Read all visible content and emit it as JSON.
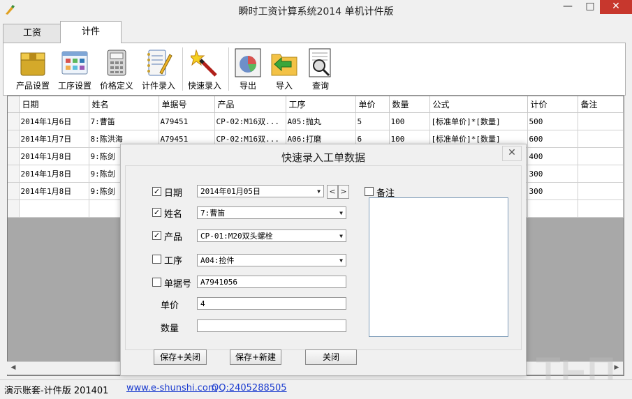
{
  "window": {
    "title": "瞬时工资计算系统2014 单机计件版",
    "minimize": "—",
    "maximize": "□",
    "close": "✕"
  },
  "tabs": [
    {
      "label": "工资",
      "active": false
    },
    {
      "label": "计件",
      "active": true
    }
  ],
  "toolbar": {
    "items": [
      {
        "label": "产品设置",
        "icon": "product-box-icon"
      },
      {
        "label": "工序设置",
        "icon": "process-grid-icon"
      },
      {
        "label": "价格定义",
        "icon": "calculator-icon"
      },
      {
        "label": "计件录入",
        "icon": "notebook-pencil-icon"
      },
      {
        "label": "快速录入",
        "icon": "magic-wand-icon"
      },
      {
        "label": "导出",
        "icon": "export-chart-icon"
      },
      {
        "label": "导入",
        "icon": "import-folder-icon"
      },
      {
        "label": "查询",
        "icon": "search-document-icon"
      }
    ]
  },
  "grid": {
    "columns": [
      "日期",
      "姓名",
      "单据号",
      "产品",
      "工序",
      "单价",
      "数量",
      "公式",
      "计价",
      "备注"
    ],
    "rows": [
      [
        "2014年1月6日",
        "7:曹笛",
        "A79451",
        "CP-02:M16双...",
        "A05:抛丸",
        "5",
        "100",
        "[标准单价]*[数量]",
        "500",
        ""
      ],
      [
        "2014年1月7日",
        "8:陈洪海",
        "A79451",
        "CP-02:M16双...",
        "A06:打磨",
        "6",
        "100",
        "[标准单价]*[数量]",
        "600",
        ""
      ],
      [
        "2014年1月8日",
        "9:陈剑",
        "",
        "",
        "",
        "",
        "",
        "",
        "400",
        ""
      ],
      [
        "2014年1月8日",
        "9:陈剑",
        "",
        "",
        "",
        "",
        "",
        "",
        "300",
        ""
      ],
      [
        "2014年1月8日",
        "9:陈剑",
        "",
        "",
        "",
        "",
        "",
        "",
        "300",
        ""
      ],
      [
        "",
        "",
        "",
        "",
        "",
        "",
        "",
        "",
        "",
        ""
      ]
    ]
  },
  "dialog": {
    "title": "快速录入工单数据",
    "close": "✕",
    "fields": {
      "date": {
        "label": "日期",
        "checked": true,
        "value": "2014年01月05日",
        "prev": "<",
        "next": ">"
      },
      "name": {
        "label": "姓名",
        "checked": true,
        "value": "7:曹笛"
      },
      "product": {
        "label": "产品",
        "checked": true,
        "value": "CP-01:M20双头螺栓"
      },
      "process": {
        "label": "工序",
        "checked": false,
        "value": "A04:捡件"
      },
      "doc_no": {
        "label": "单据号",
        "checked": false,
        "value": "A7941056"
      },
      "unit_price": {
        "label": "单价",
        "value": "4"
      },
      "quantity": {
        "label": "数量",
        "value": ""
      },
      "remark": {
        "label": "备注",
        "checked": false
      }
    },
    "buttons": {
      "save_close": "保存+关闭",
      "save_new": "保存+新建",
      "close": "关闭"
    }
  },
  "status": {
    "account": "演示账套-计件版 201401",
    "website": "www.e-shunshi.com",
    "qq": "QQ:2405288505"
  },
  "colors": {
    "close_button": "#c7372d",
    "link": "#1a3bcf",
    "grid_background": "#a8a8a8"
  }
}
